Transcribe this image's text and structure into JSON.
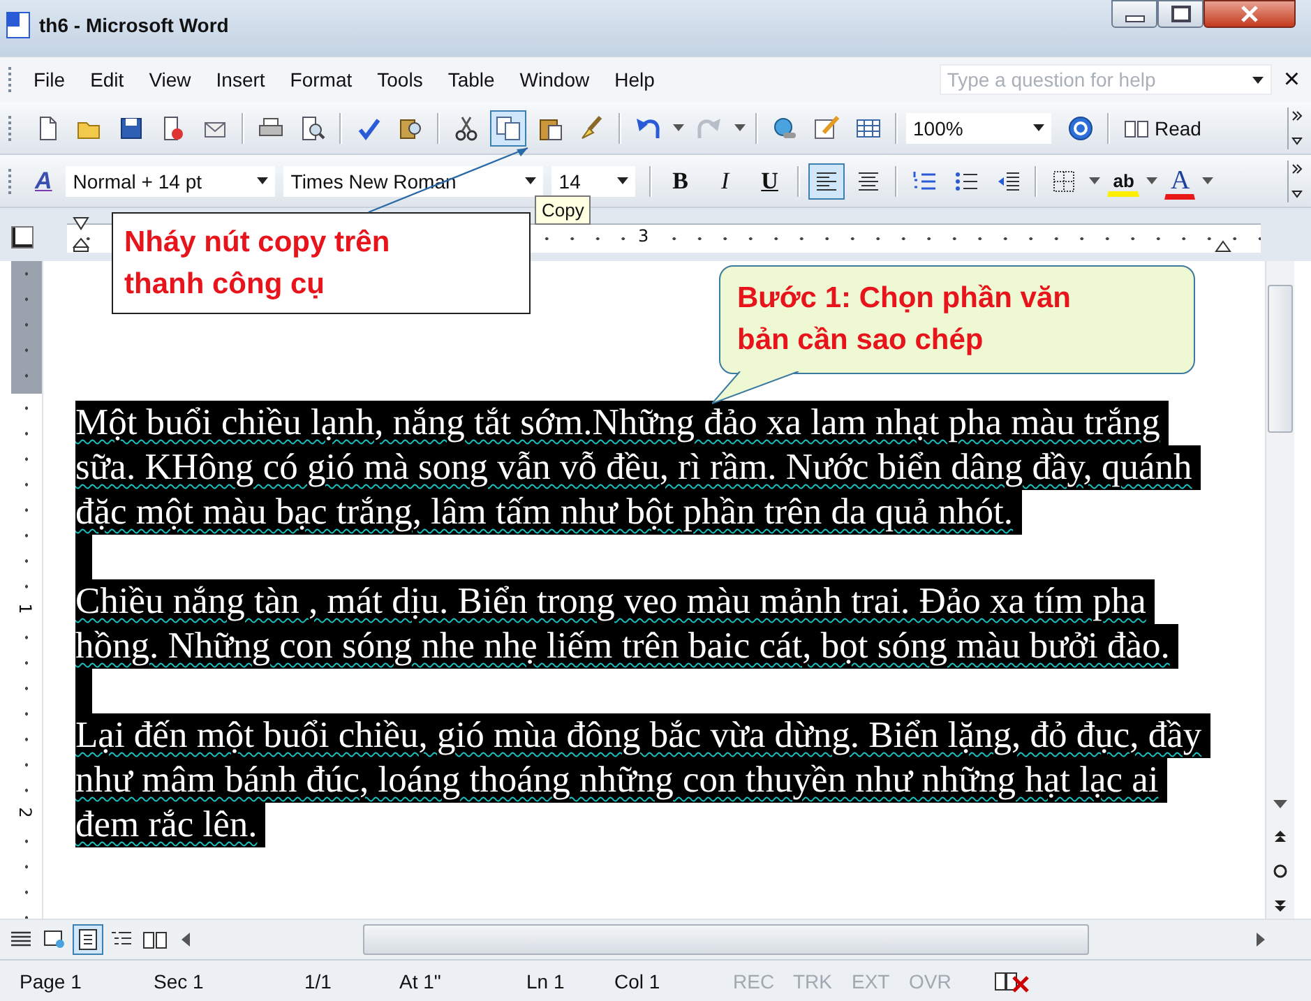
{
  "window": {
    "title": "th6 - Microsoft Word"
  },
  "menu": [
    "File",
    "Edit",
    "View",
    "Insert",
    "Format",
    "Tools",
    "Table",
    "Window",
    "Help"
  ],
  "help_box": {
    "placeholder": "Type a question for help",
    "close_glyph": "×"
  },
  "standard_toolbar": {
    "copy_highlighted": true,
    "zoom": "100%",
    "read_label": "Read"
  },
  "formatting_toolbar": {
    "styles_glyph": "A",
    "style": "Normal + 14 pt",
    "font": "Times New Roman",
    "size": "14",
    "buttons": [
      {
        "label": "B",
        "kind": "bold",
        "selected": false
      },
      {
        "label": "I",
        "kind": "italic",
        "selected": false
      },
      {
        "label": "U",
        "kind": "underline",
        "selected": false
      }
    ],
    "align_left_selected": true,
    "highlight_label": "ab",
    "font_color_label": "A"
  },
  "tooltip": "Copy",
  "ruler": {
    "horizontal_labels": [
      "3"
    ],
    "vertical_labels": [
      "1",
      "2"
    ]
  },
  "document": {
    "paragraphs": [
      {
        "kind": "text",
        "selected": true,
        "lines": [
          "Một buổi chiều lạnh, nắng tắt sớm.Những đảo xa lam nhạt pha màu trắng",
          "sữa. KHông có gió mà song vẫn vỗ đều, rì rầm. Nước biển dâng đầy, quánh",
          "đặc một màu bạc trắng, lâm tấm như bột phần trên da quả nhót."
        ]
      },
      {
        "kind": "empty",
        "selected": true
      },
      {
        "kind": "text",
        "selected": true,
        "lines": [
          "Chiều nắng tàn , mát dịu. Biển trong veo màu mảnh trai. Đảo xa tím pha",
          "hồng. Những con sóng nhe nhẹ liếm trên baic cát, bọt sóng màu bưởi đào."
        ]
      },
      {
        "kind": "empty",
        "selected": true
      },
      {
        "kind": "text",
        "selected": true,
        "lines": [
          "Lại đến một buổi chiều, gió mùa đông bắc vừa dừng. Biển lặng, đỏ đục, đầy",
          "như mâm bánh đúc, loáng thoáng những con thuyền như những hạt lạc ai",
          "đem rắc lên."
        ]
      }
    ]
  },
  "callouts": [
    {
      "kind": "box",
      "lines": [
        "Nháy nút copy trên",
        "thanh công cụ"
      ]
    },
    {
      "kind": "bubble",
      "lines": [
        "Bước 1: Chọn phần văn",
        "bản cần sao chép"
      ]
    }
  ],
  "view_buttons": [
    {
      "selected": false
    },
    {
      "selected": false
    },
    {
      "selected": true
    },
    {
      "selected": false
    },
    {
      "selected": false
    }
  ],
  "status_bar": [
    {
      "text": "Page 1",
      "disabled": false
    },
    {
      "text": "Sec 1",
      "disabled": false
    },
    {
      "text": "1/1",
      "disabled": false
    },
    {
      "text": "At 1\"",
      "disabled": false
    },
    {
      "text": "Ln 1",
      "disabled": false
    },
    {
      "text": "Col 1",
      "disabled": false
    },
    {
      "text": "REC",
      "disabled": true
    },
    {
      "text": "TRK",
      "disabled": true
    },
    {
      "text": "EXT",
      "disabled": true
    },
    {
      "text": "OVR",
      "disabled": true
    }
  ]
}
